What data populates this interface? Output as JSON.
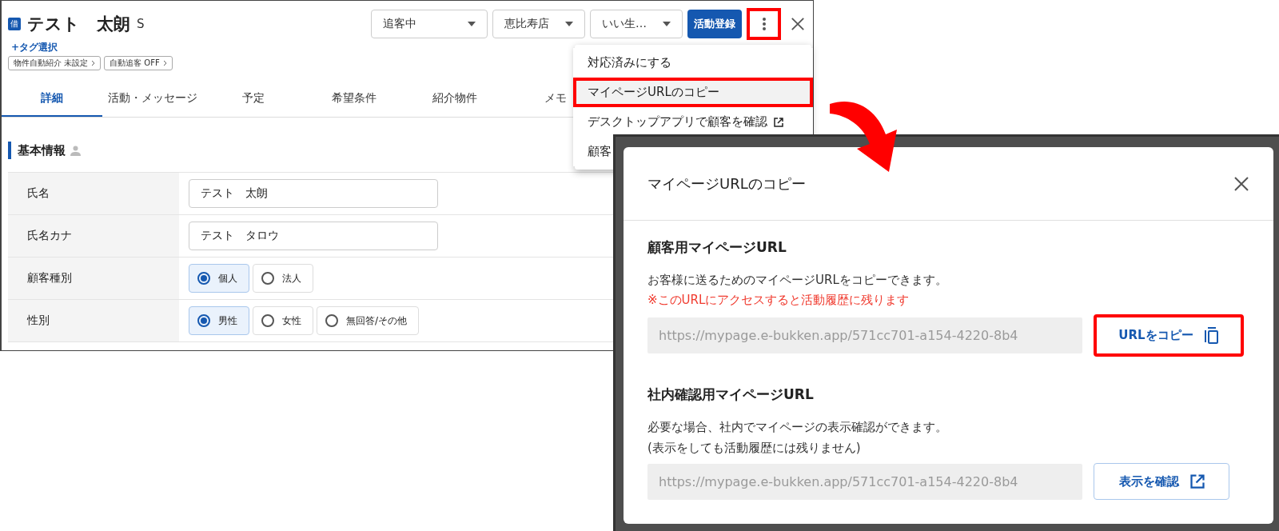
{
  "customer": {
    "badge": "借",
    "name": "テスト　太朗",
    "suffix": "S",
    "tag_link": "+タグ選択",
    "chips": [
      "物件自動紹介 未設定",
      "自動追客 OFF"
    ]
  },
  "header": {
    "selects": [
      "追客中",
      "恵比寿店",
      "いい生…"
    ],
    "primary_button": "活動登録",
    "more_highlighted": true
  },
  "menu": {
    "items": [
      {
        "label": "対応済みにする",
        "highlighted": false,
        "external": false
      },
      {
        "label": "マイページURLのコピー",
        "highlighted": true,
        "external": false
      },
      {
        "label": "デスクトップアプリで顧客を確認",
        "highlighted": false,
        "external": true
      },
      {
        "label": "顧客",
        "highlighted": false
      }
    ]
  },
  "tabs": [
    {
      "label": "詳細",
      "selected": true
    },
    {
      "label": "活動・メッセージ",
      "selected": false
    },
    {
      "label": "予定",
      "selected": false
    },
    {
      "label": "希望条件",
      "selected": false
    },
    {
      "label": "紹介物件",
      "selected": false
    },
    {
      "label": "メモ",
      "selected": false
    }
  ],
  "section_title": "基本情報",
  "rows": [
    {
      "label": "氏名",
      "kind": "text",
      "value": "テスト　太朗"
    },
    {
      "label": "氏名カナ",
      "kind": "text",
      "value": "テスト　タロウ"
    },
    {
      "label": "顧客種別",
      "kind": "radio",
      "options": [
        {
          "label": "個人",
          "selected": true
        },
        {
          "label": "法人",
          "selected": false
        }
      ]
    },
    {
      "label": "性別",
      "kind": "radio",
      "options": [
        {
          "label": "男性",
          "selected": true
        },
        {
          "label": "女性",
          "selected": false
        },
        {
          "label": "無回答/その他",
          "selected": false
        }
      ]
    }
  ],
  "modal": {
    "title": "マイページURLのコピー",
    "sections": [
      {
        "heading": "顧客用マイページURL",
        "lines": [
          "お客様に送るためのマイページURLをコピーできます。"
        ],
        "warning": "※このURLにアクセスすると活動履歴に残ります",
        "url": "https://mypage.e-bukken.app/571cc701-a154-4220-8b4",
        "button": {
          "label": "URLをコピー",
          "kind": "copy",
          "highlighted": true
        }
      },
      {
        "heading": "社内確認用マイページURL",
        "lines": [
          "必要な場合、社内でマイページの表示確認ができます。",
          "(表示をしても活動履歴には残りません)"
        ],
        "url": "https://mypage.e-bukken.app/571cc701-a154-4220-8b4",
        "button": {
          "label": "表示を確認",
          "kind": "external",
          "highlighted": false
        }
      }
    ]
  }
}
